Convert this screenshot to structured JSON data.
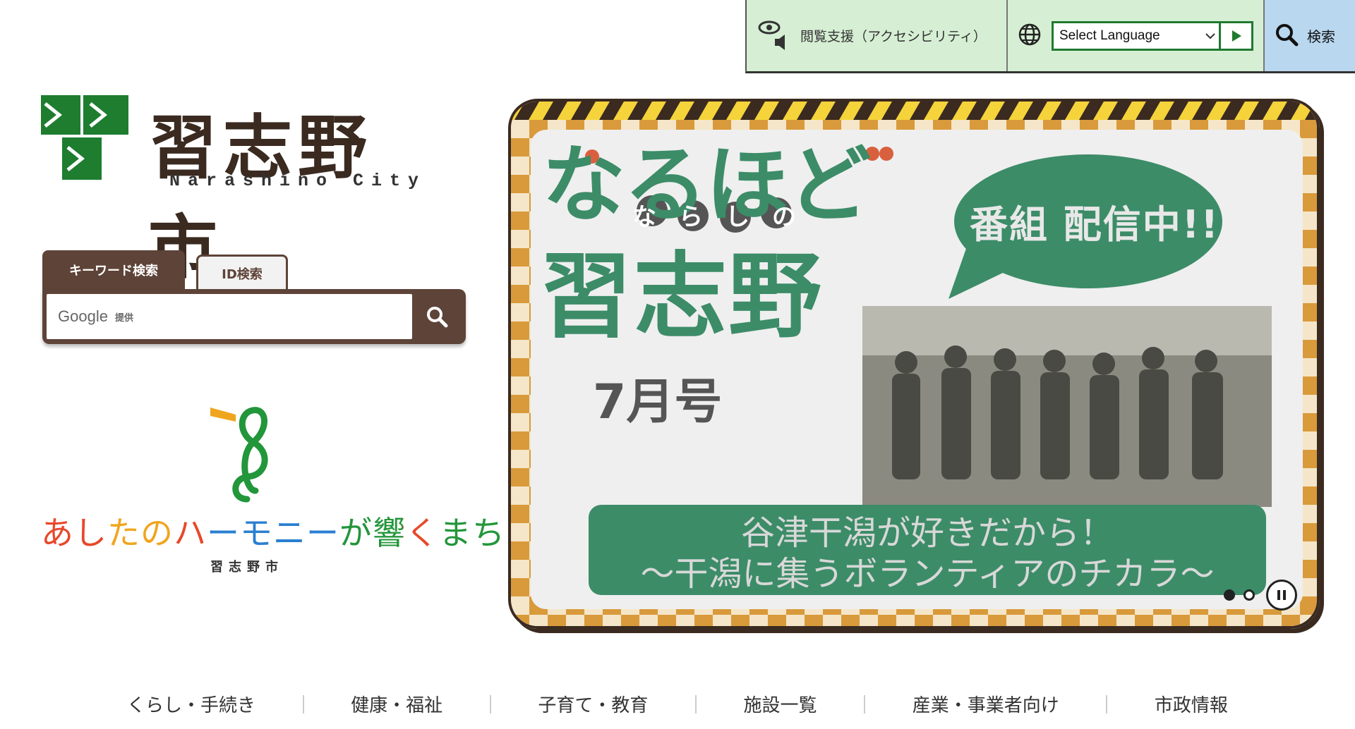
{
  "utility": {
    "accessibility_label": "閲覧支援（アクセシビリティ）",
    "language_selected": "Select Language",
    "search_label": "検索"
  },
  "logo": {
    "name_jp": "習志野市",
    "name_en": "Narashino City",
    "brand_green": "#1e7d2f"
  },
  "search": {
    "tabs": [
      {
        "label": "キーワード検索",
        "active": true
      },
      {
        "label": "ID検索",
        "active": false
      }
    ],
    "provider": "Google",
    "provider_suffix": "提供"
  },
  "slogan": {
    "phrase": "あしたのハーモニーが響くまち",
    "city": "習志野市"
  },
  "banner": {
    "title_hiragana": "なるほど",
    "title_sub": "ならしの",
    "title_kanji": "習志野",
    "issue": "7月号",
    "bubble": "番組 配信中!!",
    "caption_line1": "谷津干潟が好きだから！",
    "caption_line2": "〜干潟に集うボランティアのチカラ〜",
    "slides_total": 2,
    "slide_current": 1,
    "accent": "#3c8c68",
    "frame": "#d99a3b"
  },
  "nav": {
    "items": [
      "くらし・手続き",
      "健康・福祉",
      "子育て・教育",
      "施設一覧",
      "産業・事業者向け",
      "市政情報"
    ]
  }
}
